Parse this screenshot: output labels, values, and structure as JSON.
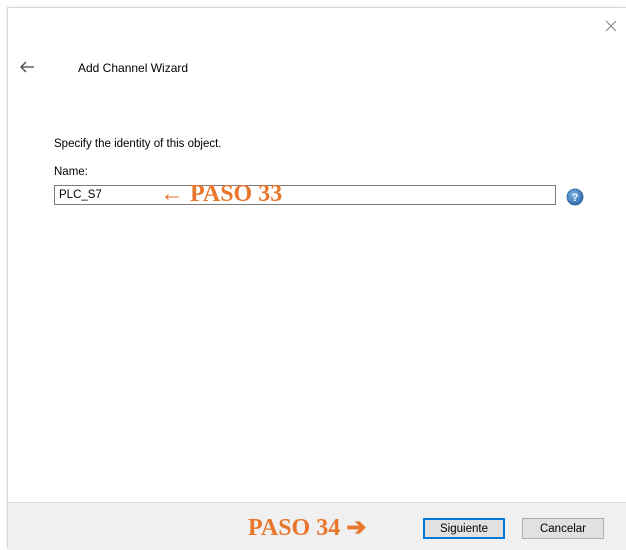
{
  "wizard": {
    "title": "Add Channel Wizard"
  },
  "form": {
    "prompt": "Specify the identity of this object.",
    "name_label": "Name:",
    "name_value": "PLC_S7"
  },
  "buttons": {
    "next_label": "Siguiente",
    "cancel_label": "Cancelar"
  },
  "annotations": {
    "step_33": "← PASO 33",
    "step_34": "PASO 34 ➔"
  },
  "icons": {
    "close": "close-icon",
    "back": "back-arrow-icon",
    "help": "help-icon"
  },
  "colors": {
    "annotation": "#e8762c",
    "accent": "#0078d7",
    "help_icon": "#3a7fc1"
  }
}
